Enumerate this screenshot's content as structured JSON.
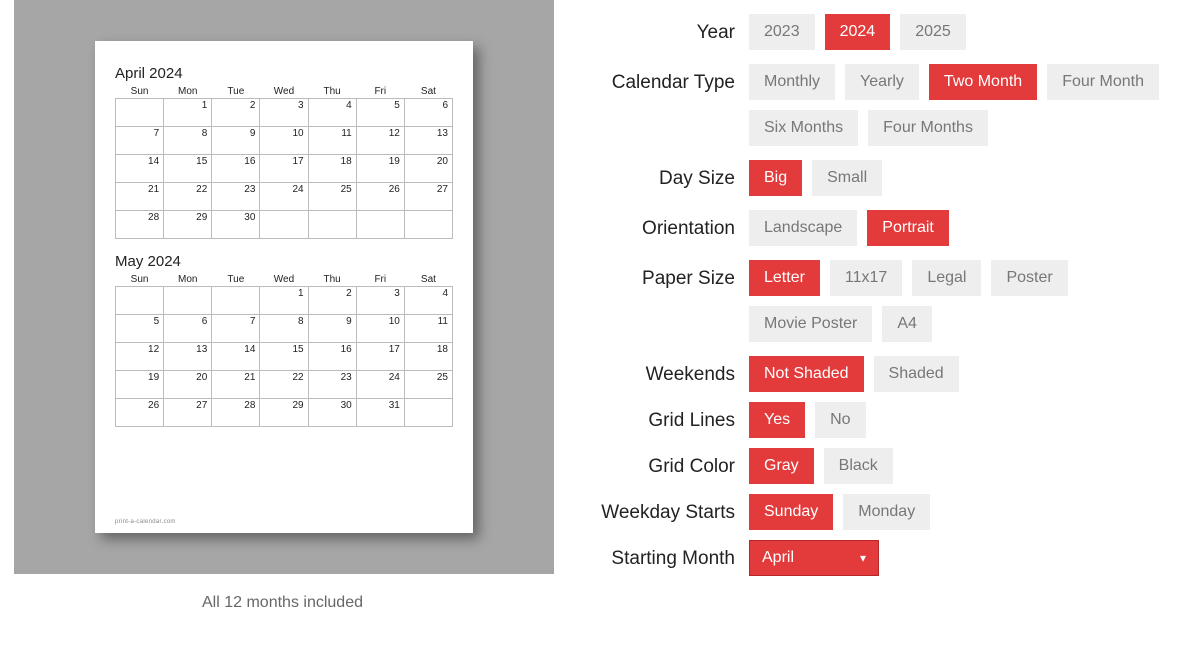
{
  "caption": "All 12 months included",
  "watermark": "print-a-calendar.com",
  "preview": {
    "month1": {
      "title": "April 2024",
      "dow": [
        "Sun",
        "Mon",
        "Tue",
        "Wed",
        "Thu",
        "Fri",
        "Sat"
      ],
      "weeks": [
        [
          "",
          "1",
          "2",
          "3",
          "4",
          "5",
          "6"
        ],
        [
          "7",
          "8",
          "9",
          "10",
          "11",
          "12",
          "13"
        ],
        [
          "14",
          "15",
          "16",
          "17",
          "18",
          "19",
          "20"
        ],
        [
          "21",
          "22",
          "23",
          "24",
          "25",
          "26",
          "27"
        ],
        [
          "28",
          "29",
          "30",
          "",
          "",
          "",
          ""
        ]
      ]
    },
    "month2": {
      "title": "May 2024",
      "dow": [
        "Sun",
        "Mon",
        "Tue",
        "Wed",
        "Thu",
        "Fri",
        "Sat"
      ],
      "weeks": [
        [
          "",
          "",
          "",
          "1",
          "2",
          "3",
          "4"
        ],
        [
          "5",
          "6",
          "7",
          "8",
          "9",
          "10",
          "11"
        ],
        [
          "12",
          "13",
          "14",
          "15",
          "16",
          "17",
          "18"
        ],
        [
          "19",
          "20",
          "21",
          "22",
          "23",
          "24",
          "25"
        ],
        [
          "26",
          "27",
          "28",
          "29",
          "30",
          "31",
          ""
        ]
      ]
    }
  },
  "controls": {
    "year": {
      "label": "Year",
      "options": [
        "2023",
        "2024",
        "2025"
      ],
      "selected": "2024"
    },
    "calendarType": {
      "label": "Calendar Type",
      "options": [
        "Monthly",
        "Yearly",
        "Two Month",
        "Four Month",
        "Six Months",
        "Four Months"
      ],
      "selected": "Two Month"
    },
    "daySize": {
      "label": "Day Size",
      "options": [
        "Big",
        "Small"
      ],
      "selected": "Big"
    },
    "orientation": {
      "label": "Orientation",
      "options": [
        "Landscape",
        "Portrait"
      ],
      "selected": "Portrait"
    },
    "paperSize": {
      "label": "Paper Size",
      "options": [
        "Letter",
        "11x17",
        "Legal",
        "Poster",
        "Movie Poster",
        "A4"
      ],
      "selected": "Letter"
    },
    "weekends": {
      "label": "Weekends",
      "options": [
        "Not Shaded",
        "Shaded"
      ],
      "selected": "Not Shaded"
    },
    "gridLines": {
      "label": "Grid Lines",
      "options": [
        "Yes",
        "No"
      ],
      "selected": "Yes"
    },
    "gridColor": {
      "label": "Grid Color",
      "options": [
        "Gray",
        "Black"
      ],
      "selected": "Gray"
    },
    "weekdayStarts": {
      "label": "Weekday Starts",
      "options": [
        "Sunday",
        "Monday"
      ],
      "selected": "Sunday"
    },
    "startingMonth": {
      "label": "Starting Month",
      "selected": "April"
    }
  }
}
